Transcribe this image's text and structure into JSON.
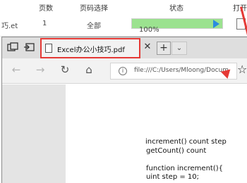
{
  "list": {
    "headers": [
      "页数",
      "页码选择",
      "状态",
      "打开"
    ],
    "row": {
      "filename": "巧.et",
      "pages": "1",
      "page_selection": "全部",
      "progress_text": "100%",
      "progress_fraction": 1.0
    }
  },
  "browser": {
    "tab": {
      "title": "Excel办公小技巧.pdf",
      "close": "✕"
    },
    "new_tab": "+",
    "tab_dropdown": "⌄",
    "nav": {
      "back": "←",
      "forward": "→",
      "refresh": "↻",
      "home": "⌂"
    },
    "address": {
      "info": "i",
      "url": "file:///C:/Users/Mloong/Docum"
    },
    "favorite": "☆"
  },
  "pdf": {
    "lines": [
      "increment() count        step",
      "getCount() count",
      "function    increment(){",
      "uint step = 10;"
    ]
  },
  "colors": {
    "annotation": "#e53935",
    "progress_fill": "#9be28f",
    "play": "#2a8be0"
  }
}
